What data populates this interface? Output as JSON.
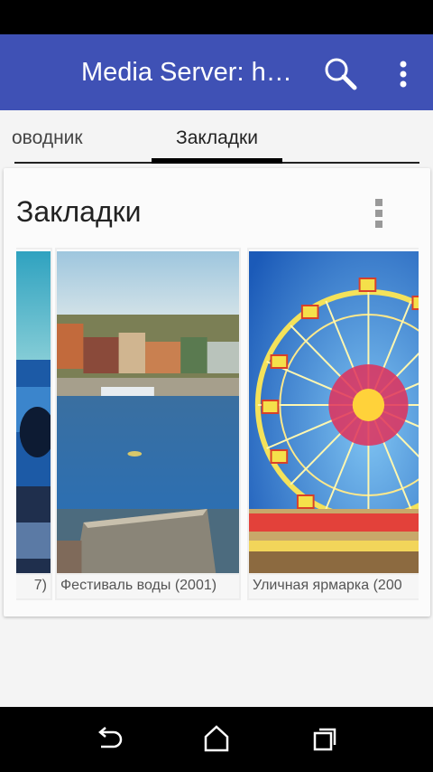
{
  "app_bar": {
    "title": "Media Server: h…",
    "icons": {
      "search": "search-icon",
      "overflow": "more-vert-icon"
    },
    "color": "#3f51b5"
  },
  "tabs": [
    {
      "label": "оводник",
      "selected": false
    },
    {
      "label": "Закладки",
      "selected": true
    }
  ],
  "card": {
    "title": "Закладки",
    "menu_icon": "more-vert-icon",
    "items": [
      {
        "caption": "7)",
        "thumbnail": "car-photo"
      },
      {
        "caption": "Фестиваль воды (2001)",
        "thumbnail": "harbor-city-photo"
      },
      {
        "caption": "Уличная ярмарка (200",
        "thumbnail": "ferris-wheel-photo"
      }
    ]
  },
  "nav_bar": {
    "icons": [
      "back-icon",
      "home-icon",
      "recent-apps-icon"
    ]
  }
}
